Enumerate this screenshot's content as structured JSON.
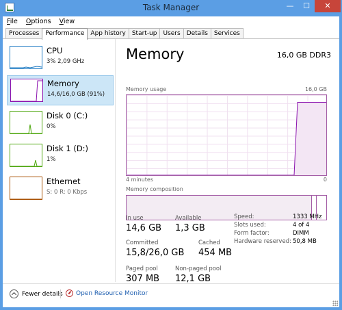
{
  "window": {
    "title": "Task Manager",
    "min_glyph": "—",
    "max_glyph": "☐",
    "close_glyph": "✕"
  },
  "menu": [
    {
      "label": "File",
      "mnemonic": "F",
      "rest": "ile"
    },
    {
      "label": "Options",
      "mnemonic": "O",
      "rest": "ptions"
    },
    {
      "label": "View",
      "mnemonic": "V",
      "rest": "iew"
    }
  ],
  "tabs": [
    "Processes",
    "Performance",
    "App history",
    "Start-up",
    "Users",
    "Details",
    "Services"
  ],
  "active_tab": "Performance",
  "sidebar": {
    "items": [
      {
        "name": "CPU",
        "value": "3% 2,09 GHz",
        "color": "#1a78c2",
        "selected": false
      },
      {
        "name": "Memory",
        "value": "14,6/16,0 GB (91%)",
        "color": "#8b12ae",
        "selected": true
      },
      {
        "name": "Disk 0 (C:)",
        "value": "0%",
        "color": "#4da60c",
        "selected": false
      },
      {
        "name": "Disk 1 (D:)",
        "value": "1%",
        "color": "#4da60c",
        "selected": false
      },
      {
        "name": "Ethernet",
        "value": "S: 0 R: 0 Kbps",
        "color": "#a74f01",
        "selected": false
      }
    ]
  },
  "main": {
    "title": "Memory",
    "spec": "16,0 GB DDR3",
    "usage_label": "Memory usage",
    "usage_max": "16,0 GB",
    "time_label": "4 minutes",
    "time_end": "0",
    "composition_label": "Memory composition",
    "accent": "#8b12ae",
    "usage_level": 0.91,
    "stats": {
      "in_use": {
        "label": "In use",
        "value": "14,6 GB"
      },
      "available": {
        "label": "Available",
        "value": "1,3 GB"
      },
      "committed": {
        "label": "Committed",
        "value": "15,8/26,0 GB"
      },
      "cached": {
        "label": "Cached",
        "value": "454 MB"
      },
      "paged_pool": {
        "label": "Paged pool",
        "value": "307 MB"
      },
      "non_paged_pool": {
        "label": "Non-paged pool",
        "value": "12,1 GB"
      }
    },
    "specs": [
      {
        "key": "Speed:",
        "value": "1333 MHz"
      },
      {
        "key": "Slots used:",
        "value": "4 of 4"
      },
      {
        "key": "Form factor:",
        "value": "DIMM"
      },
      {
        "key": "Hardware reserved:",
        "value": "50,8 MB"
      }
    ]
  },
  "footer": {
    "fewer_details": "Fewer details",
    "fewer_mnemonic": "d",
    "open_resmon": "Open Resource Monitor"
  }
}
